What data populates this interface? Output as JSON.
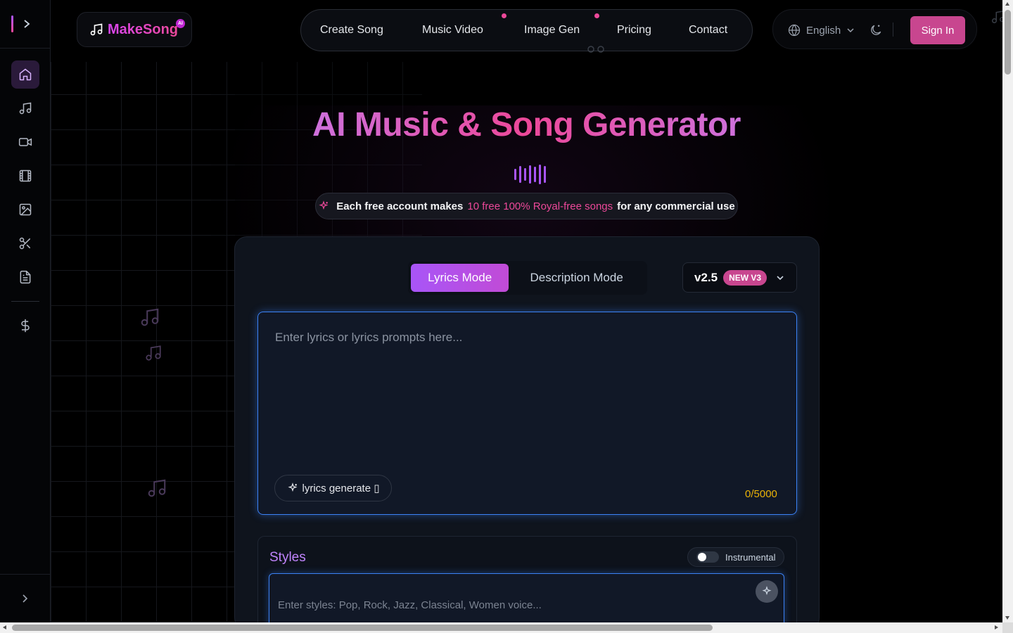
{
  "brand": {
    "name": "MakeSong",
    "badge": "AI",
    "accent_color": "#ec4899",
    "secondary_color": "#a855f7"
  },
  "nav": {
    "items": [
      {
        "label": "Create Song",
        "has_dot": false
      },
      {
        "label": "Music Video",
        "has_dot": true
      },
      {
        "label": "Image Gen",
        "has_dot": true
      },
      {
        "label": "Pricing",
        "has_dot": false
      },
      {
        "label": "Contact",
        "has_dot": false
      }
    ]
  },
  "header": {
    "language": "English",
    "sign_in_label": "Sign In"
  },
  "sidebar": {
    "items": [
      {
        "icon": "home-icon",
        "active": true
      },
      {
        "icon": "music-note-icon",
        "active": false
      },
      {
        "icon": "video-camera-icon",
        "active": false
      },
      {
        "icon": "film-icon",
        "active": false
      },
      {
        "icon": "image-icon",
        "active": false
      },
      {
        "icon": "scissors-icon",
        "active": false
      },
      {
        "icon": "document-icon",
        "active": false
      },
      {
        "icon": "dollar-icon",
        "active": false
      }
    ]
  },
  "hero": {
    "title": "AI Music & Song Generator",
    "promo_before": "Each free account makes",
    "promo_highlight": "10 free 100% Royal-free songs",
    "promo_after": "for any commercial use"
  },
  "generator": {
    "modes": [
      {
        "label": "Lyrics Mode",
        "active": true
      },
      {
        "label": "Description Mode",
        "active": false
      }
    ],
    "version": "v2.5",
    "version_badge": "NEW V3",
    "lyrics_placeholder": "Enter lyrics or lyrics prompts here...",
    "lyrics_generate_label": "lyrics generate ▯",
    "char_counter": "0/5000",
    "styles_title": "Styles",
    "instrumental_label": "Instrumental",
    "instrumental_on": false,
    "styles_placeholder": "Enter styles: Pop, Rock, Jazz, Classical, Women voice..."
  }
}
